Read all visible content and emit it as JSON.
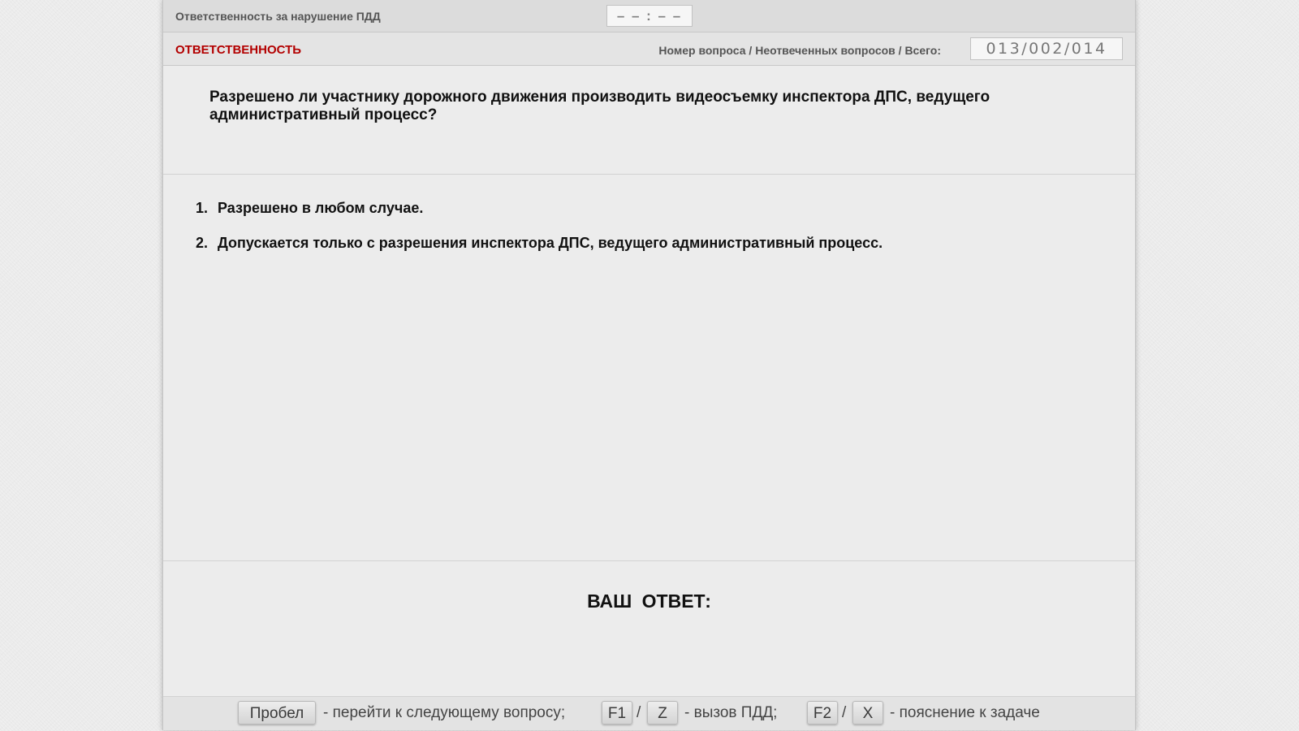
{
  "header": {
    "topic_title": "Ответственность за нарушение ПДД",
    "timer": "– – : – –"
  },
  "subheader": {
    "category": "ОТВЕТСТВЕННОСТЬ",
    "counter_label": "Номер вопроса / Неотвеченных вопросов / Всего:",
    "counter_value": "013/002/014"
  },
  "question": {
    "text": "Разрешено ли участнику дорожного движения производить видеосъемку инспектора ДПС, ведущего административный процесс?"
  },
  "answers": [
    {
      "number": "1.",
      "text": "Разрешено в любом случае."
    },
    {
      "number": "2.",
      "text": "Допускается только с разрешения инспектора ДПС, ведущего административный процесс."
    }
  ],
  "your_answer": {
    "label": "ВАШ  ОТВЕТ:"
  },
  "hotkeys": {
    "space_key": "Пробел",
    "space_desc": "- перейти к следующему вопросу;",
    "f1_key": "F1",
    "z_key": "Z",
    "slash": "/",
    "rules_desc": "- вызов ПДД;",
    "f2_key": "F2",
    "x_key": "X",
    "explain_desc": "- пояснение к задаче"
  }
}
